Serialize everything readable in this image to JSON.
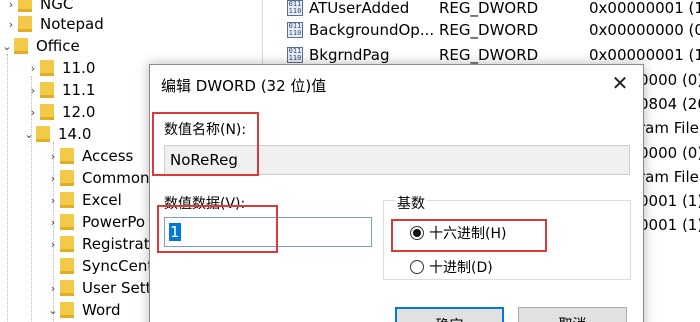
{
  "tree": {
    "items": [
      {
        "label": "NGC",
        "level": 1,
        "expanded": false
      },
      {
        "label": "Notepad",
        "level": 1,
        "expanded": false
      },
      {
        "label": "Office",
        "level": 1,
        "expanded": true
      },
      {
        "label": "11.0",
        "level": 2,
        "expanded": false
      },
      {
        "label": "11.1",
        "level": 2,
        "expanded": false
      },
      {
        "label": "12.0",
        "level": 2,
        "expanded": false
      },
      {
        "label": "14.0",
        "level": 2,
        "expanded": true
      },
      {
        "label": "Access",
        "level": 3,
        "expanded": false
      },
      {
        "label": "Common",
        "level": 3,
        "expanded": false
      },
      {
        "label": "Excel",
        "level": 3,
        "expanded": false
      },
      {
        "label": "PowerPo",
        "level": 3,
        "expanded": false
      },
      {
        "label": "Registrat",
        "level": 3,
        "expanded": false
      },
      {
        "label": "SyncCent",
        "level": 3,
        "expanded": null
      },
      {
        "label": "User Sett",
        "level": 3,
        "expanded": false
      },
      {
        "label": "Word",
        "level": 3,
        "expanded": false
      }
    ]
  },
  "list": {
    "rows": [
      {
        "name": "ATUserAdded",
        "type": "REG_DWORD",
        "data": "0x00000001 (1)"
      },
      {
        "name": "BackgroundOp...",
        "type": "REG_DWORD",
        "data": "0x00000000 (0)"
      },
      {
        "name": "BkgrndPag",
        "type": "REG_DWORD",
        "data": "0x00000001 (1)"
      },
      {
        "name": "",
        "type": "",
        "data": "0000 (0)"
      },
      {
        "name": "",
        "type": "",
        "data": "0804 (20"
      },
      {
        "name": "",
        "type": "",
        "data": "ram File"
      },
      {
        "name": "",
        "type": "",
        "data": "0000 (0)"
      },
      {
        "name": "",
        "type": "",
        "data": "ram File"
      },
      {
        "name": "",
        "type": "",
        "data": "0001 (1)"
      },
      {
        "name": "",
        "type": "",
        "data": "0001 (1)"
      }
    ]
  },
  "dialog": {
    "title": "编辑 DWORD (32 位)值",
    "close_icon": "✕",
    "value_name_label": "数值名称(N):",
    "value_name": "NoReReg",
    "value_data_label": "数值数据(V):",
    "value_data": "1",
    "base_label": "基数",
    "base_options": [
      {
        "label": "十六进制(H)",
        "selected": true
      },
      {
        "label": "十进制(D)",
        "selected": false
      }
    ],
    "ok_label": "确定",
    "cancel_label": "取消"
  },
  "icons": {
    "folder": "folder-icon",
    "chevron_right": "›",
    "chevron_down": "⌄",
    "reg_value": "registry-value-icon"
  },
  "colors": {
    "highlight": "#d93a3a",
    "folder": "#f3c948",
    "selection": "#0078d7"
  }
}
